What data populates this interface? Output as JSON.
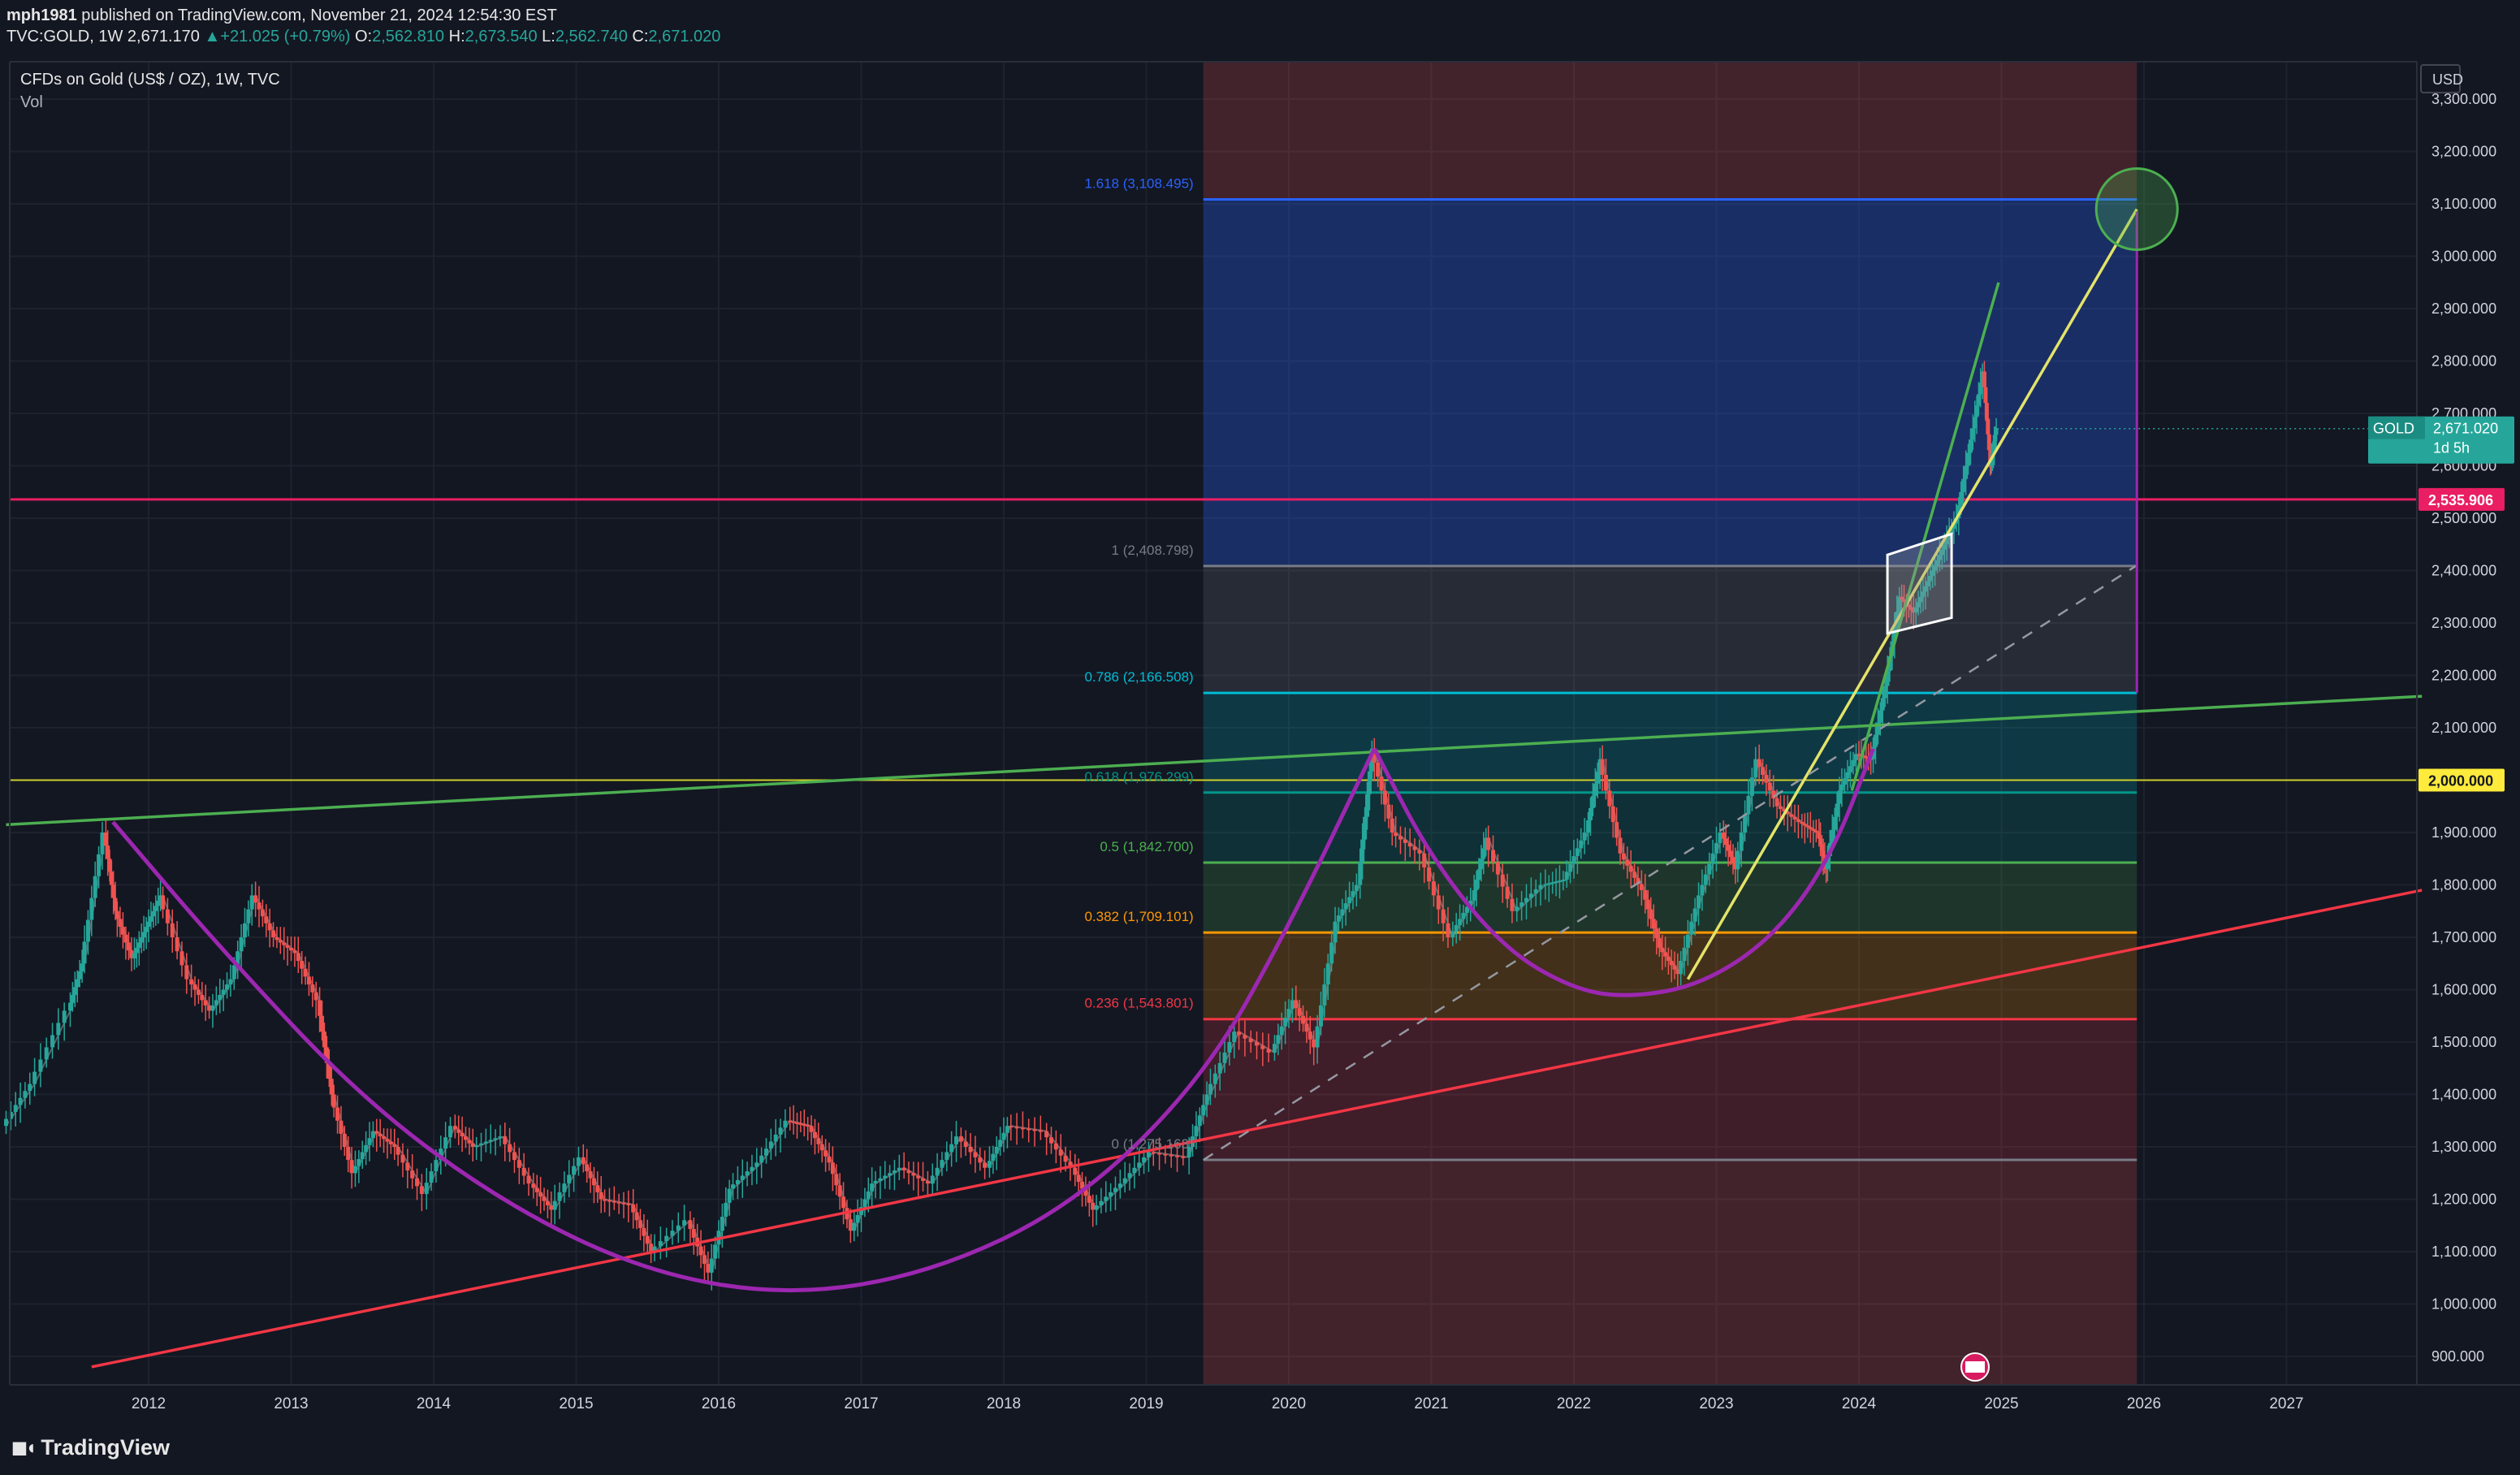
{
  "header": {
    "author": "mph1981",
    "published_text": " published on TradingView.com, November 21, 2024 12:54:30 EST",
    "symbol_line": "TVC:GOLD, 1W",
    "last": "2,671.170",
    "change": "+21.025 (+0.79%)",
    "o_label": "O:",
    "o": "2,562.810",
    "h_label": "H:",
    "h": "2,673.540",
    "l_label": "L:",
    "l": "2,562.740",
    "c_label": "C:",
    "c": "2,671.020"
  },
  "legend": {
    "title": "CFDs on Gold (US$ / OZ), 1W, TVC",
    "vol": "Vol"
  },
  "price_axis": {
    "currency": "USD",
    "current_symbol": "GOLD",
    "current_price": "2,671.020",
    "countdown": "1d 5h",
    "line_price_label": "2,535.906",
    "level_label": "2,000.000"
  },
  "footer": {
    "brand": "TradingView"
  },
  "colors": {
    "background": "#131722",
    "up": "#26a69a",
    "down": "#ef5350",
    "purple": "#9c27b0",
    "yellow_line": "#e3e36a",
    "green_line": "#4caf50",
    "red_line": "#f23645",
    "pink_line": "#e91e63"
  },
  "chart_data": {
    "type": "candlestick",
    "timeframe": "1W",
    "x_ticks": [
      "2012",
      "2013",
      "2014",
      "2015",
      "2016",
      "2017",
      "2018",
      "2019",
      "2020",
      "2021",
      "2022",
      "2023",
      "2024",
      "2025",
      "2026",
      "2027"
    ],
    "y_ticks": [
      900,
      1000,
      1100,
      1200,
      1300,
      1400,
      1500,
      1600,
      1700,
      1800,
      1900,
      2000,
      2100,
      2200,
      2300,
      2400,
      2500,
      2600,
      2700,
      2800,
      2900,
      3000,
      3100,
      3200,
      3300
    ],
    "y_tick_labels": [
      "900.000",
      "1,000.000",
      "1,100.000",
      "1,200.000",
      "1,300.000",
      "1,400.000",
      "1,500.000",
      "1,600.000",
      "1,700.000",
      "1,800.000",
      "1,900.000",
      "2,000.000",
      "2,100.000",
      "2,200.000",
      "2,300.000",
      "2,400.000",
      "2,500.000",
      "2,600.000",
      "2,700.000",
      "2,800.000",
      "2,900.000",
      "3,000.000",
      "3,100.000",
      "3,200.000",
      "3,300.000"
    ],
    "ylim": [
      880,
      3420
    ],
    "xlim": [
      2011.0,
      2027.95
    ],
    "price_path": [
      [
        2011.0,
        1340
      ],
      [
        2011.2,
        1420
      ],
      [
        2011.45,
        1560
      ],
      [
        2011.55,
        1650
      ],
      [
        2011.7,
        1900
      ],
      [
        2011.78,
        1750
      ],
      [
        2011.9,
        1660
      ],
      [
        2012.0,
        1720
      ],
      [
        2012.1,
        1780
      ],
      [
        2012.3,
        1620
      ],
      [
        2012.45,
        1560
      ],
      [
        2012.6,
        1620
      ],
      [
        2012.75,
        1780
      ],
      [
        2012.9,
        1700
      ],
      [
        2013.05,
        1670
      ],
      [
        2013.2,
        1580
      ],
      [
        2013.3,
        1400
      ],
      [
        2013.45,
        1250
      ],
      [
        2013.6,
        1330
      ],
      [
        2013.75,
        1300
      ],
      [
        2013.95,
        1210
      ],
      [
        2014.15,
        1340
      ],
      [
        2014.3,
        1300
      ],
      [
        2014.5,
        1320
      ],
      [
        2014.7,
        1230
      ],
      [
        2014.85,
        1180
      ],
      [
        2015.05,
        1280
      ],
      [
        2015.2,
        1200
      ],
      [
        2015.4,
        1190
      ],
      [
        2015.55,
        1100
      ],
      [
        2015.8,
        1160
      ],
      [
        2015.95,
        1060
      ],
      [
        2016.1,
        1220
      ],
      [
        2016.3,
        1270
      ],
      [
        2016.5,
        1350
      ],
      [
        2016.65,
        1340
      ],
      [
        2016.8,
        1270
      ],
      [
        2016.95,
        1140
      ],
      [
        2017.1,
        1230
      ],
      [
        2017.3,
        1260
      ],
      [
        2017.5,
        1230
      ],
      [
        2017.7,
        1320
      ],
      [
        2017.9,
        1260
      ],
      [
        2018.05,
        1340
      ],
      [
        2018.3,
        1330
      ],
      [
        2018.5,
        1260
      ],
      [
        2018.65,
        1180
      ],
      [
        2018.85,
        1230
      ],
      [
        2019.05,
        1290
      ],
      [
        2019.3,
        1280
      ],
      [
        2019.45,
        1400
      ],
      [
        2019.65,
        1520
      ],
      [
        2019.9,
        1480
      ],
      [
        2020.05,
        1580
      ],
      [
        2020.2,
        1490
      ],
      [
        2020.35,
        1730
      ],
      [
        2020.5,
        1800
      ],
      [
        2020.6,
        2060
      ],
      [
        2020.75,
        1900
      ],
      [
        2020.95,
        1860
      ],
      [
        2021.15,
        1700
      ],
      [
        2021.3,
        1770
      ],
      [
        2021.4,
        1890
      ],
      [
        2021.6,
        1750
      ],
      [
        2021.8,
        1800
      ],
      [
        2021.95,
        1810
      ],
      [
        2022.1,
        1900
      ],
      [
        2022.2,
        2040
      ],
      [
        2022.35,
        1860
      ],
      [
        2022.5,
        1790
      ],
      [
        2022.62,
        1680
      ],
      [
        2022.75,
        1630
      ],
      [
        2022.9,
        1780
      ],
      [
        2023.05,
        1900
      ],
      [
        2023.15,
        1830
      ],
      [
        2023.3,
        2040
      ],
      [
        2023.45,
        1950
      ],
      [
        2023.6,
        1920
      ],
      [
        2023.72,
        1900
      ],
      [
        2023.78,
        1830
      ],
      [
        2023.88,
        1980
      ],
      [
        2024.0,
        2050
      ],
      [
        2024.1,
        2040
      ],
      [
        2024.2,
        2180
      ],
      [
        2024.3,
        2350
      ],
      [
        2024.4,
        2320
      ],
      [
        2024.5,
        2380
      ],
      [
        2024.6,
        2440
      ],
      [
        2024.7,
        2500
      ],
      [
        2024.8,
        2650
      ],
      [
        2024.88,
        2780
      ],
      [
        2024.93,
        2600
      ],
      [
        2024.97,
        2671
      ]
    ],
    "fib_levels": [
      {
        "ratio": 1.618,
        "price": 3108.495,
        "label": "1.618 (3,108.495)",
        "color": "#2962ff"
      },
      {
        "ratio": 1,
        "price": 2408.798,
        "label": "1 (2,408.798)",
        "color": "#787b86"
      },
      {
        "ratio": 0.786,
        "price": 2166.508,
        "label": "0.786 (2,166.508)",
        "color": "#00bcd4"
      },
      {
        "ratio": 0.618,
        "price": 1976.299,
        "label": "0.618 (1,976.299)",
        "color": "#009688"
      },
      {
        "ratio": 0.5,
        "price": 1842.7,
        "label": "0.5 (1,842.700)",
        "color": "#4caf50"
      },
      {
        "ratio": 0.382,
        "price": 1709.101,
        "label": "0.382 (1,709.101)",
        "color": "#ff9800"
      },
      {
        "ratio": 0.236,
        "price": 1543.801,
        "label": "0.236 (1,543.801)",
        "color": "#f23645"
      },
      {
        "ratio": 0,
        "price": 1275.163,
        "label": "0 (1,275.163)",
        "color": "#787b86"
      }
    ],
    "fib_x_range": [
      2019.4,
      2025.95
    ],
    "horizontal_lines": [
      {
        "price": 2535.906,
        "color": "#e91e63"
      },
      {
        "price": 2000.0,
        "color": "#cdcd2a"
      }
    ],
    "trend_lines": [
      {
        "name": "green-trendline",
        "from": [
          2011.0,
          1915
        ],
        "to": [
          2027.95,
          2160
        ],
        "color": "#4caf50"
      },
      {
        "name": "red-trendline",
        "from": [
          2011.6,
          880
        ],
        "to": [
          2027.95,
          1790
        ],
        "color": "#f23645"
      },
      {
        "name": "yellow-trendline",
        "from": [
          2022.8,
          1620
        ],
        "to": [
          2025.95,
          3090
        ],
        "color": "#e3e36a"
      },
      {
        "name": "dashed-diagonal",
        "from": [
          2019.4,
          1275
        ],
        "to": [
          2025.95,
          2410
        ],
        "color": "#9598a1"
      },
      {
        "name": "green-steep-line",
        "from": [
          2023.95,
          1980
        ],
        "to": [
          2024.98,
          2950
        ],
        "color": "#4caf50"
      }
    ],
    "arcs": [
      {
        "name": "purple-arc-large",
        "color": "#9c27b0",
        "points": [
          [
            2011.75,
            1920
          ],
          [
            2012.5,
            1680
          ],
          [
            2013.5,
            1390
          ],
          [
            2014.5,
            1190
          ],
          [
            2015.5,
            1060
          ],
          [
            2016.5,
            1015
          ],
          [
            2017.5,
            1060
          ],
          [
            2018.5,
            1190
          ],
          [
            2019.4,
            1430
          ],
          [
            2020.0,
            1720
          ],
          [
            2020.6,
            2060
          ]
        ]
      },
      {
        "name": "purple-arc-small",
        "color": "#9c27b0",
        "points": [
          [
            2020.6,
            2060
          ],
          [
            2021.0,
            1850
          ],
          [
            2021.5,
            1680
          ],
          [
            2022.0,
            1600
          ],
          [
            2022.4,
            1585
          ],
          [
            2022.9,
            1610
          ],
          [
            2023.4,
            1700
          ],
          [
            2023.8,
            1850
          ],
          [
            2024.1,
            2060
          ]
        ]
      }
    ],
    "target_circle": {
      "center": [
        2025.95,
        3090
      ],
      "label": "target"
    },
    "vertical_projection": {
      "x": 2025.95,
      "from": 3085,
      "to": 2166.5,
      "color": "#9c27b0"
    }
  }
}
